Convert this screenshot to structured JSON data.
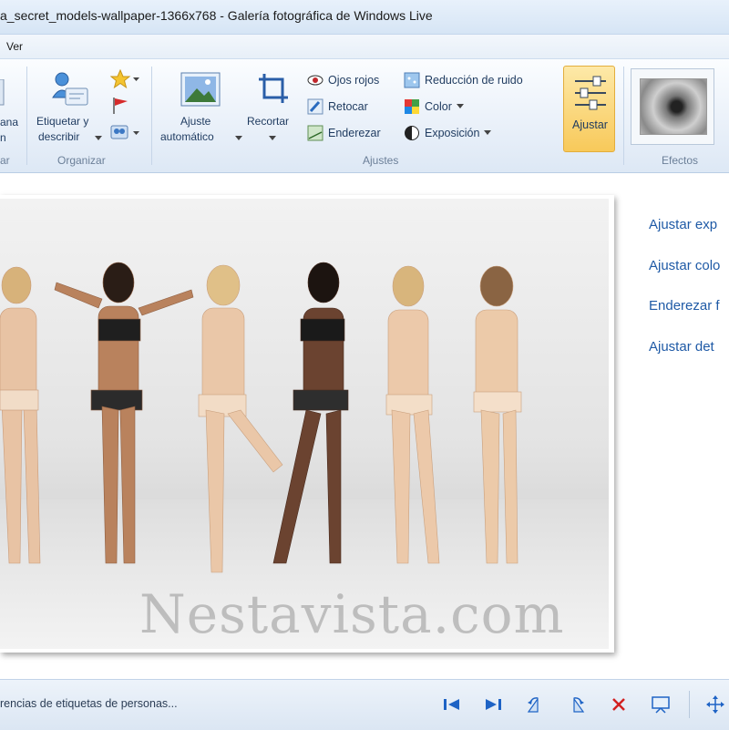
{
  "window": {
    "title": "a_secret_models-wallpaper-1366x768 - Galería fotográfica de Windows Live"
  },
  "menu": {
    "items": [
      "Ver"
    ]
  },
  "ribbon": {
    "group_left": {
      "label_partial": "ar",
      "button_line1": "ana",
      "button_line2": "n"
    },
    "organizar": {
      "label": "Organizar",
      "tag_button_line1": "Etiquetar y",
      "tag_button_line2": "describir"
    },
    "ajustes": {
      "label": "Ajustes",
      "auto_line1": "Ajuste",
      "auto_line2": "automático",
      "crop": "Recortar",
      "red_eye": "Ojos rojos",
      "retouch": "Retocar",
      "straighten": "Enderezar",
      "noise": "Reducción de ruido",
      "color": "Color",
      "exposure": "Exposición",
      "adjust": "Ajustar"
    },
    "efectos": {
      "label": "Efectos"
    }
  },
  "content": {
    "watermark": "Nestavista.com",
    "side_panel": [
      "Ajustar exp",
      "Ajustar colo",
      "Enderezar f",
      "Ajustar det"
    ]
  },
  "statusbar": {
    "text": "rencias de etiquetas de personas..."
  },
  "colors": {
    "accent": "#f8c95a",
    "link": "#1f5aa6",
    "nav_icon": "#1e63c5",
    "delete_icon": "#d22020"
  }
}
